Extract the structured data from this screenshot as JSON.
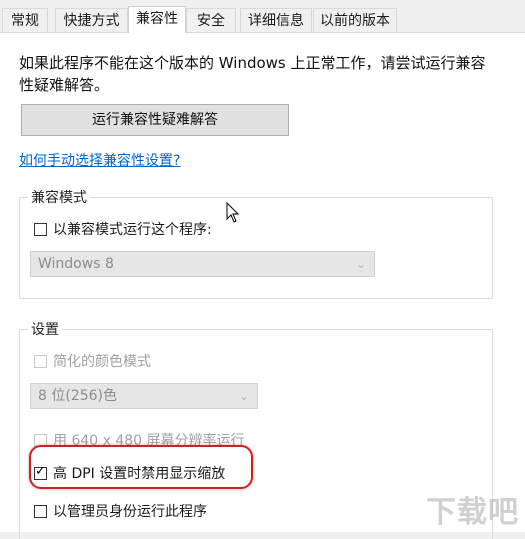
{
  "tabs": [
    {
      "label": "常规"
    },
    {
      "label": "快捷方式"
    },
    {
      "label": "兼容性"
    },
    {
      "label": "安全"
    },
    {
      "label": "详细信息"
    },
    {
      "label": "以前的版本"
    }
  ],
  "intro_text": "如果此程序不能在这个版本的 Windows 上正常工作，请尝试运行兼容性疑难解答。",
  "troubleshoot_button": "运行兼容性疑难解答",
  "manual_link": "如何手动选择兼容性设置?",
  "compat_mode": {
    "title": "兼容模式",
    "checkbox_label": "以兼容模式运行这个程序:",
    "checked": false,
    "os_select": {
      "value": "Windows 8",
      "icon": "chevron-down-icon"
    }
  },
  "settings": {
    "title": "设置",
    "reduced_color": {
      "label": "简化的颜色模式",
      "checked": false,
      "enabled": false
    },
    "color_select": {
      "value": "8 位(256)色",
      "icon": "chevron-down-icon"
    },
    "resolution": {
      "label": "用 640 x 480 屏幕分辨率运行",
      "checked": false,
      "enabled": false
    },
    "high_dpi": {
      "label": "高 DPI 设置时禁用显示缩放",
      "checked": true,
      "enabled": true
    },
    "run_as_admin": {
      "label": "以管理员身份运行此程序",
      "checked": false,
      "enabled": true
    }
  },
  "annotation": {
    "color": "#cc2222"
  },
  "watermark": {
    "text": "下载吧",
    "sub": "www.xiazaiba.com"
  }
}
